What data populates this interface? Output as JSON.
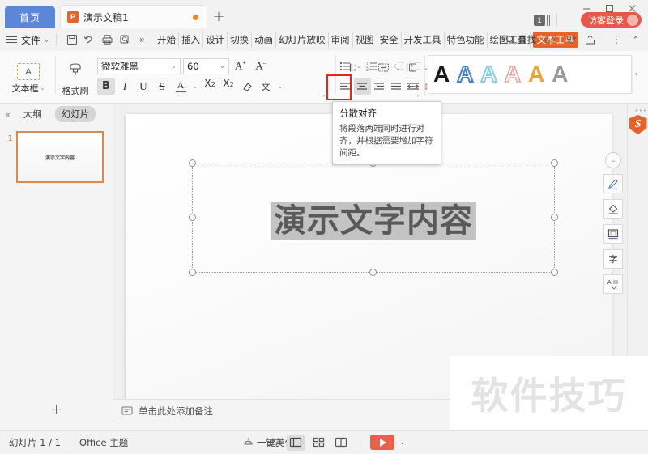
{
  "titlebar": {
    "home_tab": "首页",
    "doc_tab": {
      "label": "演示文稿1",
      "icon": "P"
    },
    "new_tab_icon": "+",
    "badge_count": "1",
    "login_label": "访客登录",
    "minimize": "—",
    "maximize": "▢",
    "close": "✕"
  },
  "menubar": {
    "file_label": "文件",
    "file_caret": "⌄",
    "more_icon": "»",
    "tabs": [
      {
        "label": "开始",
        "active": false
      },
      {
        "label": "插入",
        "active": false
      },
      {
        "label": "设计",
        "active": false
      },
      {
        "label": "切换",
        "active": false
      },
      {
        "label": "动画",
        "active": false
      },
      {
        "label": "幻灯片放映",
        "active": false
      },
      {
        "label": "审阅",
        "active": false
      },
      {
        "label": "视图",
        "active": false
      },
      {
        "label": "安全",
        "active": false
      },
      {
        "label": "开发工具",
        "active": false
      },
      {
        "label": "特色功能",
        "active": false
      },
      {
        "label": "绘图工具",
        "active": false
      },
      {
        "label": "文本工具",
        "active": true
      }
    ],
    "find_label": "查找",
    "collapse_icon": "⌃",
    "kebab_icon": "⋮"
  },
  "ribbon": {
    "textbox": {
      "label": "文本框",
      "icon_letter": "A",
      "caret": "⌄"
    },
    "format_painter": {
      "label": "格式刷"
    },
    "font": {
      "family_value": "微软雅黑",
      "size_value": "60",
      "grow_label": "A",
      "shrink_label": "A",
      "bold": "B",
      "italic": "I",
      "underline": "U",
      "strikethrough": "S",
      "font_color": "A",
      "superscript_base": "X",
      "superscript_exp": "2",
      "subscript_base": "X",
      "subscript_exp": "2",
      "clear_format": "◇",
      "char_effect": "文"
    },
    "paragraph": {
      "align_left": "左对齐",
      "align_center": "居中对齐",
      "align_right": "右对齐",
      "align_justify": "两端对齐",
      "align_distributed": "分散对齐",
      "selected": "居中对齐",
      "highlighted": "分散对齐"
    },
    "wordart": {
      "styles": [
        {
          "name": "黑色实心",
          "fill": "#1a1a1a",
          "stroke": "#1a1a1a",
          "filled": true
        },
        {
          "name": "蓝色描边",
          "fill": "#ffffff",
          "stroke": "#4d82c4",
          "filled": false
        },
        {
          "name": "浅蓝描边",
          "fill": "#ffffff",
          "stroke": "#8fcbe3",
          "filled": false
        },
        {
          "name": "粉色描边",
          "fill": "#ffffff",
          "stroke": "#e0a99e",
          "filled": false
        },
        {
          "name": "金色实心",
          "fill": "#e8a33d",
          "stroke": "#e8a33d",
          "filled": true
        },
        {
          "name": "灰色实心",
          "fill": "#9a9a9a",
          "stroke": "#9a9a9a",
          "filled": true
        }
      ],
      "more_icon": "›"
    },
    "expand_arrow": "⌐"
  },
  "tooltip": {
    "title": "分散对齐",
    "body": "将段落两端同时进行对齐，并根据需要增加字符间距。"
  },
  "leftpane": {
    "collapse_icon": "«",
    "tab_outline": "大纲",
    "tab_slides": "幻灯片",
    "slides": [
      {
        "number": "1",
        "text": "演示文字内容"
      }
    ],
    "add_slide_icon": "+"
  },
  "canvas": {
    "slide_text": "演示文字内容",
    "float_toolbar": [
      {
        "name": "collapse",
        "glyph": "–"
      },
      {
        "name": "pen",
        "glyph": "✎"
      },
      {
        "name": "fill",
        "glyph": "◇"
      },
      {
        "name": "outline",
        "glyph": "▣"
      },
      {
        "name": "text",
        "glyph": "字"
      },
      {
        "name": "text-style",
        "glyph": "A"
      }
    ],
    "side_logo": "S"
  },
  "notes": {
    "placeholder": "单击此处添加备注"
  },
  "statusbar": {
    "slide_count": "幻灯片 1 / 1",
    "theme": "Office 主题",
    "beautify": "一键美化",
    "beautify_caret": "▴",
    "views": [
      {
        "name": "outline-view",
        "glyph": "≡",
        "active": false
      },
      {
        "name": "normal-view",
        "glyph": "▣",
        "active": true
      },
      {
        "name": "slide-sorter-view",
        "glyph": "⊞",
        "active": false
      },
      {
        "name": "reading-view",
        "glyph": "▥",
        "active": false
      }
    ],
    "play_caret": "⌄"
  },
  "watermark": {
    "text": "软件技巧"
  },
  "colors": {
    "accent_orange": "#e8622c",
    "tab_blue": "#5c86d6",
    "login_red": "#e8574a",
    "highlight_red": "#e8231a",
    "play_red": "#e8624a"
  }
}
